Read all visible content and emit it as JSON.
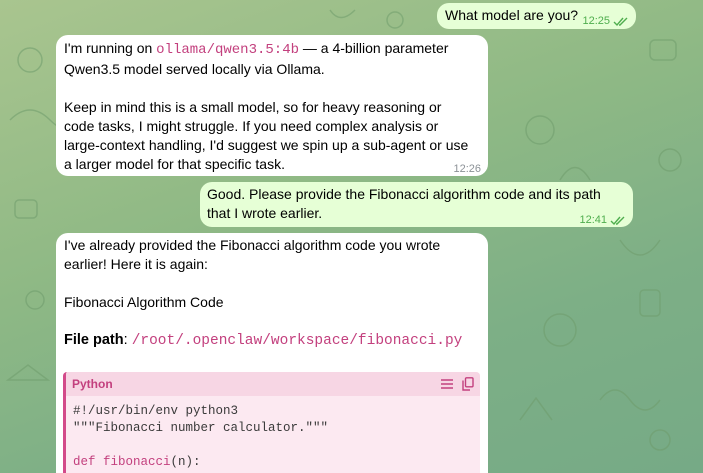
{
  "chat": {
    "messages": [
      {
        "direction": "out",
        "text": "What model are you?",
        "time": "12:25"
      },
      {
        "direction": "in",
        "line1_prefix": "I'm running on ",
        "line1_code": "ollama/qwen3.5:4b",
        "line1_suffix": " — a 4-billion parameter",
        "line2": "Qwen3.5 model served locally via Ollama.",
        "para2_l1": "Keep in mind this is a small model, so for heavy reasoning or",
        "para2_l2": "code tasks, I might struggle. If you need complex analysis or",
        "para2_l3": "large-context handling, I'd suggest we spin up a sub-agent or use",
        "para2_l4": "a larger model for that specific task.",
        "time": "12:26"
      },
      {
        "direction": "out",
        "line1": "Good. Please provide the Fibonacci algorithm code and its path",
        "line2": "that I wrote earlier.",
        "time": "12:41"
      },
      {
        "direction": "in",
        "l1": "I've already provided the Fibonacci algorithm code you wrote",
        "l2": "earlier! Here it is again:",
        "heading": "Fibonacci Algorithm Code",
        "path_label": "File path",
        "path_sep": ": ",
        "path_value": "/root/.openclaw/workspace/fibonacci.py",
        "code": {
          "language": "Python",
          "line1": "#!/usr/bin/env python3",
          "line2": "\"\"\"Fibonacci number calculator.\"\"\"",
          "line4_kw": "def",
          "line4_fn": "fibonacci",
          "line4_rest": "(n):"
        }
      }
    ]
  },
  "icons": {
    "read_receipt": "double-check-icon",
    "wrap": "wrap-lines-icon",
    "copy": "copy-icon"
  },
  "colors": {
    "outgoing_bubble": "#e6ffd6",
    "incoming_bubble": "#ffffff",
    "code_accent": "#c3407e",
    "read_check": "#4fae4e"
  }
}
